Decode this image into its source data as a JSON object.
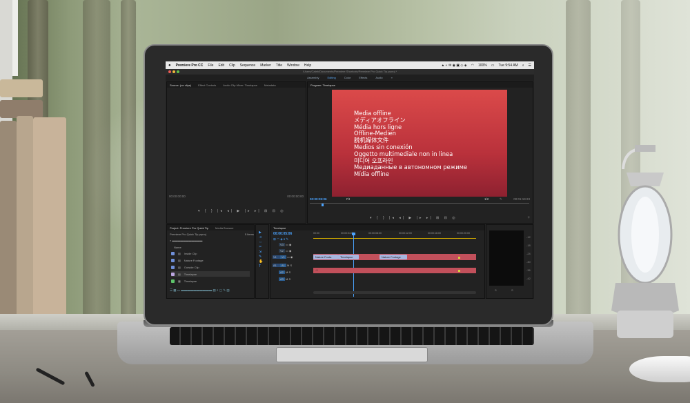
{
  "menubar": {
    "app_name": "Premiere Pro CC",
    "items": [
      "File",
      "Edit",
      "Clip",
      "Sequence",
      "Marker",
      "Title",
      "Window",
      "Help"
    ],
    "battery": "100%",
    "clock": "Tue 9:54 AM"
  },
  "window": {
    "path": "/Users/Caleb/Documents/Premiere Shortcuts/Premiere Pro Quick Tip.prproj *"
  },
  "workspaces": {
    "items": [
      "Assembly",
      "Editing",
      "Color",
      "Effects",
      "Audio"
    ],
    "more": "»"
  },
  "source_panel": {
    "tabs": [
      "Source: (no clips)",
      "Effect Controls",
      "Audio Clip Mixer: Timelapse",
      "Metadata"
    ],
    "timecode_left": "00:00:00:00",
    "timecode_right": "00:00:00:00",
    "controls": "▾  {  }  |◂  ◂|  ▶  |▸  ▸|  ⊞  ⊟  ◎"
  },
  "program_panel": {
    "tab": "Program: Timelapse",
    "offline_lines": [
      "Media offline",
      "メディアオフライン",
      "Média hors ligne",
      "Offline-Medien",
      "脱机媒体文件",
      "Medios sin conexión",
      "Oggetto multimediale non in linea",
      "미디어 오프라인",
      "Медиаданные в автономном режиме",
      "Mídia offline"
    ],
    "timecode_left": "00:00:05:06",
    "fit": "Fit",
    "fraction": "1/2",
    "timecode_right": "00:01:19:23",
    "controls": "▾  {  }  |◂  ◂|  ▶  |▸  ▸|  ⊞  ⊟  ◎"
  },
  "project_panel": {
    "tabs": [
      "Project: Premiere Pro Quick Tip",
      "Media Browser"
    ],
    "file": "Premiere Pro Quick Tip.prproj",
    "item_count": "5 Items",
    "column": "Name",
    "items": [
      {
        "name": "Inside Clip",
        "color": "#6f8fd8"
      },
      {
        "name": "Nature Footage",
        "color": "#6f8fd8"
      },
      {
        "name": "Outside Clip",
        "color": "#6f8fd8"
      },
      {
        "name": "Timelapse",
        "color": "#bca6e0"
      },
      {
        "name": "Timelapse",
        "color": "#5ec46b"
      }
    ]
  },
  "timeline_panel": {
    "tab": "Timelapse",
    "timecode": "00:00:05:06",
    "ruler": [
      "00:00",
      "00:00:04:00",
      "00:00:08:00",
      "00:00:12:00",
      "00:00:16:00",
      "00:00:20:00"
    ],
    "tracks": [
      "V3",
      "V2",
      "V1",
      "A1",
      "A2",
      "A3"
    ],
    "clips_v1": [
      "Nature Foota",
      "Timelapse",
      "Nature Footage"
    ],
    "audio_value": "-1"
  },
  "meter": {
    "scale": [
      "-12",
      "-18",
      "-24",
      "-30",
      "-36",
      "-42",
      "-48"
    ],
    "labels": [
      "S",
      "S"
    ]
  }
}
